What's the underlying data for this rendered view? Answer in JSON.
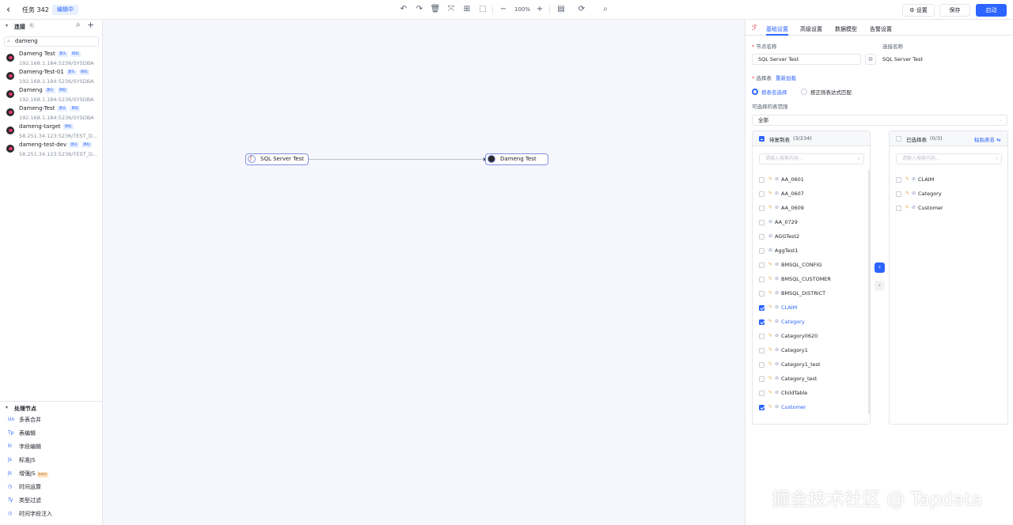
{
  "topbar": {
    "title": "任务 342",
    "status_badge": "编辑中",
    "zoom": "100%",
    "settings_label": "设置",
    "save_label": "保存",
    "start_label": "启动"
  },
  "left": {
    "connections_header": "连接",
    "connections_count": "6",
    "search_value": "dameng",
    "connections": [
      {
        "name": "Dameng Test",
        "address": "192.168.1.184:5236/SYSDBA",
        "tags": [
          "源头",
          "目标"
        ]
      },
      {
        "name": "Dameng-Test-01",
        "address": "192.168.1.184:5236/SYSDBA",
        "tags": [
          "源头",
          "目标"
        ]
      },
      {
        "name": "Dameng",
        "address": "192.168.1.184:5236/SYSDBA",
        "tags": [
          "源头",
          "目标"
        ]
      },
      {
        "name": "Dameng-Test",
        "address": "192.168.1.184:5236/SYSDBA",
        "tags": [
          "源头",
          "目标"
        ]
      },
      {
        "name": "dameng-target",
        "address": "58.251.34.123:5236/TEST_D...",
        "tags": [
          "目标"
        ]
      },
      {
        "name": "dameng-test-dev",
        "address": "58.251.34.123:5236/TEST_D...",
        "tags": [
          "源头",
          "目标"
        ]
      }
    ],
    "processing_header": "处理节点",
    "processors": [
      {
        "icon": "Un",
        "label": "多表合并",
        "badge": ""
      },
      {
        "icon": "Tp",
        "label": "表编辑",
        "badge": ""
      },
      {
        "icon": "Fr",
        "label": "字段编辑",
        "badge": ""
      },
      {
        "icon": "Js",
        "label": "标准JS",
        "badge": ""
      },
      {
        "icon": "Js",
        "label": "增强JS",
        "badge": "beta"
      },
      {
        "icon": "◷",
        "label": "时间运算",
        "badge": ""
      },
      {
        "icon": "Ty",
        "label": "类型过滤",
        "badge": ""
      },
      {
        "icon": "◷",
        "label": "时间字段注入",
        "badge": ""
      }
    ]
  },
  "canvas": {
    "source_node": "SQL Server Test",
    "target_node": "Dameng Test"
  },
  "right": {
    "tabs": [
      "基础设置",
      "高级设置",
      "数据模型",
      "告警设置"
    ],
    "node_name_label": "节点名称",
    "node_name_value": "SQL Server Test",
    "connection_name_label": "连接名称",
    "connection_name_value": "SQL Server Test",
    "select_table_label": "选择表",
    "reload_label": "重新加载",
    "radio_by_name": "按表名选择",
    "radio_by_regex": "按正则表达式匹配",
    "range_label": "可选择的表范围",
    "range_value": "全部",
    "source_panel_title": "待复制表",
    "source_panel_count": "(3/234)",
    "target_panel_title": "已选择表",
    "target_panel_count": "(0/3)",
    "paste_label": "粘贴表名",
    "search_placeholder": "请输入搜索内容...",
    "source_tables": [
      {
        "name": "AA_0601",
        "checked": false,
        "key": true
      },
      {
        "name": "AA_0607",
        "checked": false,
        "key": true
      },
      {
        "name": "AA_0609",
        "checked": false,
        "key": true
      },
      {
        "name": "AA_0729",
        "checked": false,
        "key": false
      },
      {
        "name": "AGGTest2",
        "checked": false,
        "key": false
      },
      {
        "name": "AggTest1",
        "checked": false,
        "key": false
      },
      {
        "name": "BMSQL_CONFIG",
        "checked": false,
        "key": true
      },
      {
        "name": "BMSQL_CUSTOMER",
        "checked": false,
        "key": true
      },
      {
        "name": "BMSQL_DISTRICT",
        "checked": false,
        "key": true
      },
      {
        "name": "CLAIM",
        "checked": true,
        "key": true
      },
      {
        "name": "Category",
        "checked": true,
        "key": true
      },
      {
        "name": "Category0620",
        "checked": false,
        "key": true
      },
      {
        "name": "Category1",
        "checked": false,
        "key": true
      },
      {
        "name": "Category1_test",
        "checked": false,
        "key": true
      },
      {
        "name": "Category_test",
        "checked": false,
        "key": true
      },
      {
        "name": "ChildTable",
        "checked": false,
        "key": true
      },
      {
        "name": "Customer",
        "checked": true,
        "key": true
      }
    ],
    "target_tables": [
      {
        "name": "CLAIM",
        "key": true
      },
      {
        "name": "Category",
        "key": true
      },
      {
        "name": "Customer",
        "key": true
      }
    ]
  },
  "watermark": "掘金技术社区 @ Tapdata",
  "colors": {
    "accent": "#2c65ff",
    "canvas_bg": "#f5f7fd",
    "node_border": "#8290e0"
  }
}
